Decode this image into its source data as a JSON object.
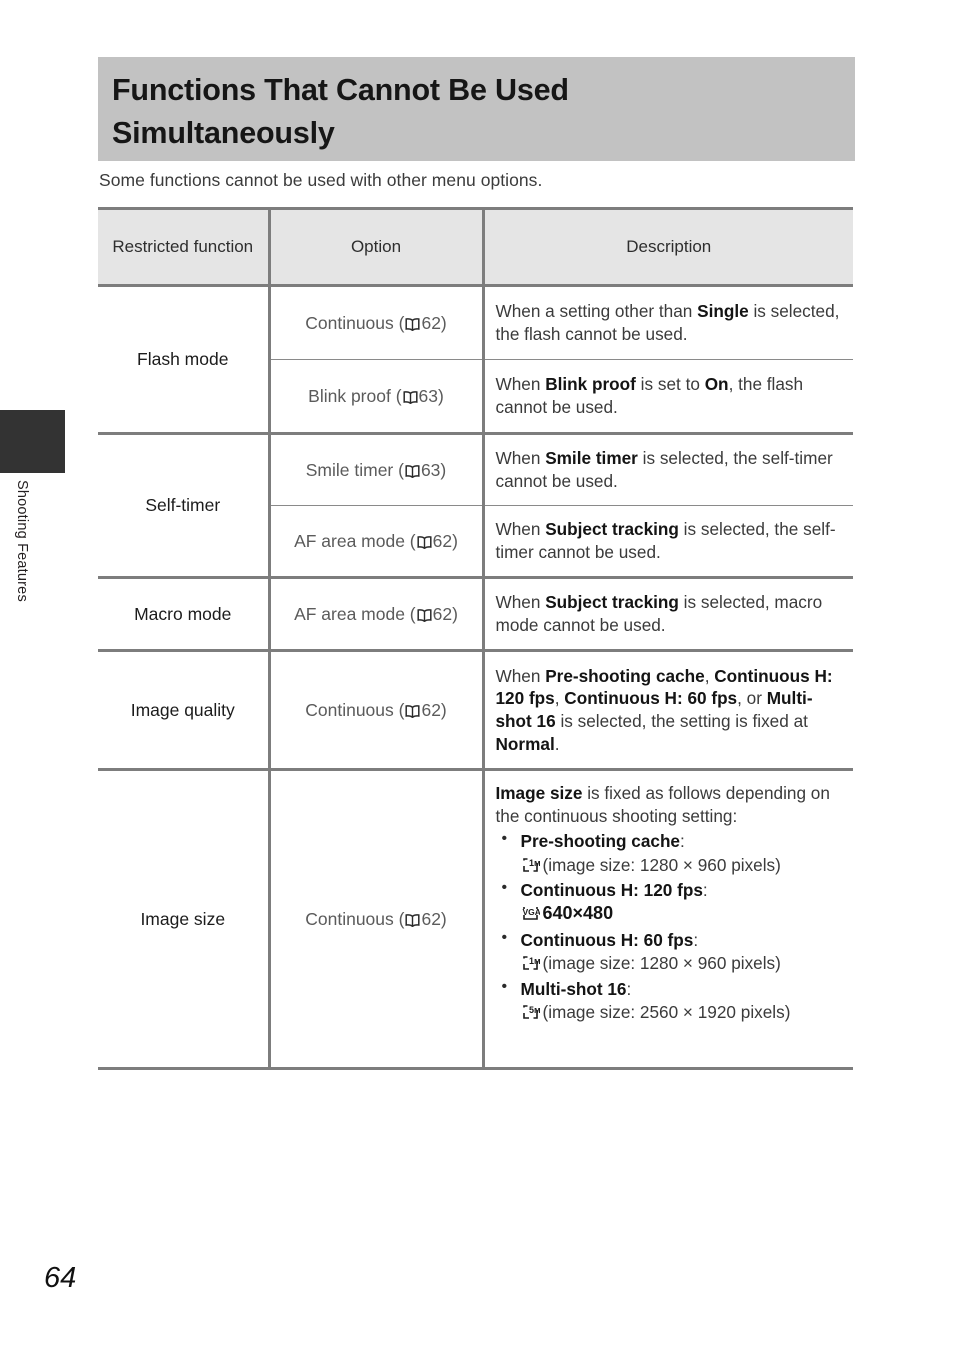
{
  "sidebar": {
    "tab_label": "Shooting Features"
  },
  "page": {
    "title": "Functions That Cannot Be Used Simultaneously",
    "intro": "Some functions cannot be used with other menu options.",
    "page_number": "64"
  },
  "table": {
    "headers": {
      "col1": "Restricted function",
      "col2": "Option",
      "col3": "Description"
    },
    "rows": [
      {
        "function": "Flash mode",
        "subrows": [
          {
            "option": "Continuous (",
            "option_page": "62)",
            "desc_prefix": "When a setting other than ",
            "desc_bold1": "Single",
            "desc_suffix": " is selected, the flash cannot be used."
          },
          {
            "option": "Blink proof (",
            "option_page": "63)",
            "desc_prefix": "When ",
            "desc_bold1": "Blink proof",
            "desc_mid": " is set to ",
            "desc_bold2": "On",
            "desc_suffix": ", the flash cannot be used."
          }
        ]
      },
      {
        "function": "Self-timer",
        "subrows": [
          {
            "option": "Smile timer (",
            "option_page": "63)",
            "desc_prefix": "When ",
            "desc_bold1": "Smile timer",
            "desc_suffix": " is selected, the self-timer cannot be used."
          },
          {
            "option": "AF area mode (",
            "option_page": "62)",
            "desc_prefix": "When ",
            "desc_bold1": "Subject tracking",
            "desc_suffix": " is selected, the self-timer cannot be used."
          }
        ]
      },
      {
        "function": "Macro mode",
        "subrows": [
          {
            "option": "AF area mode (",
            "option_page": "62)",
            "desc_prefix": "When ",
            "desc_bold1": "Subject tracking",
            "desc_suffix": " is selected, macro mode cannot be used."
          }
        ]
      },
      {
        "function": "Image quality",
        "subrows": [
          {
            "option": "Continuous (",
            "option_page": "62)",
            "desc_prefix": "When ",
            "desc_bold1": "Pre-shooting cache",
            "desc_sep1": ", ",
            "desc_bold2": "Continuous H: 120 fps",
            "desc_sep2": ", ",
            "desc_bold3": "Continuous H: 60 fps",
            "desc_sep3": ", or ",
            "desc_bold4": "Multi-shot 16",
            "desc_sep4": " is selected, the setting is fixed at ",
            "desc_bold5": "Normal",
            "desc_suffix": "."
          }
        ]
      },
      {
        "function": "Image size",
        "subrows": [
          {
            "option": "Continuous (",
            "option_page": "62)",
            "lead_bold": "Image size",
            "lead_rest": " is fixed as follows depending on the continuous shooting setting:",
            "bullets": [
              {
                "label": "Pre-shooting cache",
                "colon": ":",
                "icon": "size-1m-icon",
                "icon_text": "1m",
                "value": "(image size: 1280 × 960 pixels)",
                "value_bold": false
              },
              {
                "label": "Continuous H: 120 fps",
                "colon": ":",
                "icon": "size-vga-icon",
                "icon_text": "VGA",
                "value": "640×480",
                "value_bold": true
              },
              {
                "label": "Continuous H: 60 fps",
                "colon": ":",
                "icon": "size-1m-icon",
                "icon_text": "1m",
                "value": "(image size: 1280 × 960 pixels)",
                "value_bold": false
              },
              {
                "label": "Multi-shot 16",
                "colon": ":",
                "icon": "size-5m-icon",
                "icon_text": "5m",
                "value": "(image size: 2560 × 1920 pixels)",
                "value_bold": false
              }
            ]
          }
        ]
      }
    ]
  },
  "colors": {
    "title_banner_bg": "#c2c2c2",
    "table_header_bg": "#e5e5e5",
    "rule": "#7d7d7d",
    "side_tab": "#333333"
  }
}
